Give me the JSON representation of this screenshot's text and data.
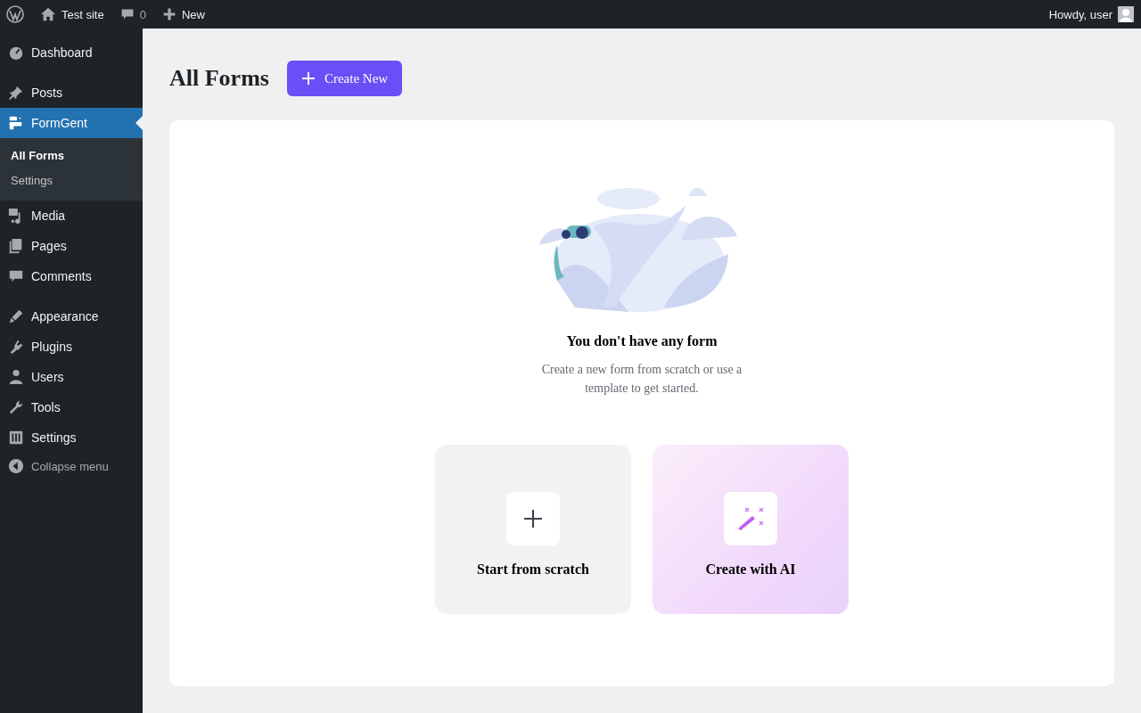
{
  "admin_bar": {
    "site_name": "Test site",
    "comments_count": "0",
    "new_label": "New",
    "greeting": "Howdy, user"
  },
  "sidebar": {
    "groups": [
      [
        {
          "label": "Dashboard",
          "selected": false
        }
      ],
      [
        {
          "label": "Posts",
          "selected": false
        },
        {
          "label": "FormGent",
          "selected": true,
          "children": [
            {
              "label": "All Forms",
              "selected": true
            },
            {
              "label": "Settings",
              "selected": false
            }
          ]
        },
        {
          "label": "Media",
          "selected": false
        },
        {
          "label": "Pages",
          "selected": false
        },
        {
          "label": "Comments",
          "selected": false
        }
      ],
      [
        {
          "label": "Appearance",
          "selected": false
        },
        {
          "label": "Plugins",
          "selected": false
        },
        {
          "label": "Users",
          "selected": false
        },
        {
          "label": "Tools",
          "selected": false
        },
        {
          "label": "Settings",
          "selected": false
        }
      ]
    ],
    "collapse_label": "Collapse menu"
  },
  "page": {
    "title": "All Forms",
    "create_button": "Create New"
  },
  "empty_state": {
    "title": "You don't have any form",
    "description": "Create a new form from scratch or use a template to get started."
  },
  "options": [
    {
      "kind": "scratch",
      "label": "Start from scratch"
    },
    {
      "kind": "ai",
      "label": "Create with AI"
    }
  ]
}
